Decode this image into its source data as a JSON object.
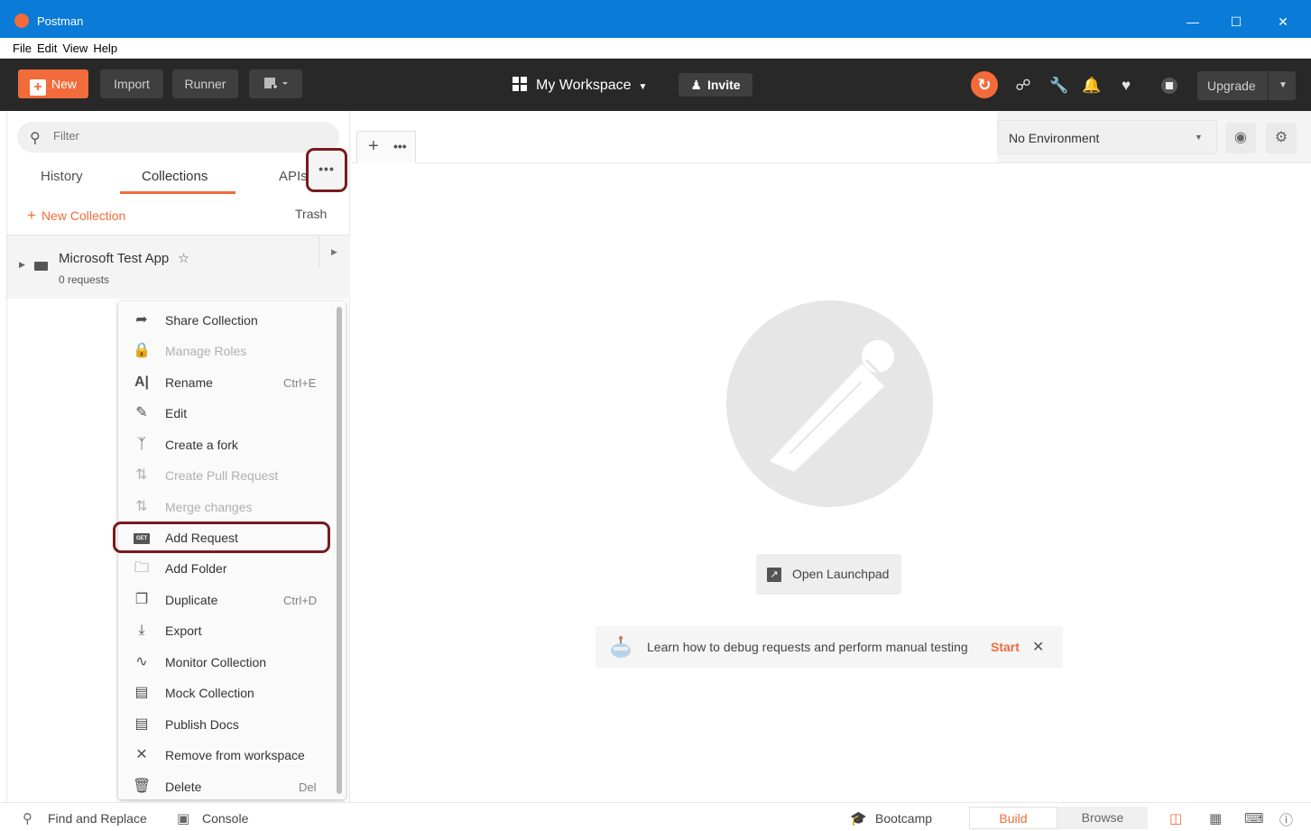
{
  "window": {
    "title": "Postman",
    "minimize": "—",
    "maximize": "☐",
    "close": "✕"
  },
  "menubar": [
    "File",
    "Edit",
    "View",
    "Help"
  ],
  "toolbar": {
    "new_label": "New",
    "import_label": "Import",
    "runner_label": "Runner",
    "workspace_label": "My Workspace",
    "invite_label": "Invite",
    "upgrade_label": "Upgrade"
  },
  "sidebar": {
    "filter_placeholder": "Filter",
    "tabs": [
      "History",
      "Collections",
      "APIs"
    ],
    "active_tab": "Collections",
    "new_collection_label": "New Collection",
    "trash_label": "Trash",
    "collection": {
      "name": "Microsoft Test App",
      "count": "0 requests"
    }
  },
  "context_menu": {
    "items": [
      {
        "label": "Share Collection",
        "icon": "share-arrow-icon",
        "shortcut": "",
        "disabled": false
      },
      {
        "label": "Manage Roles",
        "icon": "lock-icon",
        "shortcut": "",
        "disabled": true
      },
      {
        "label": "Rename",
        "icon": "rename-icon",
        "shortcut": "Ctrl+E",
        "disabled": false
      },
      {
        "label": "Edit",
        "icon": "pencil-icon",
        "shortcut": "",
        "disabled": false
      },
      {
        "label": "Create a fork",
        "icon": "fork-icon",
        "shortcut": "",
        "disabled": false
      },
      {
        "label": "Create Pull Request",
        "icon": "pull-request-icon",
        "shortcut": "",
        "disabled": true
      },
      {
        "label": "Merge changes",
        "icon": "merge-icon",
        "shortcut": "",
        "disabled": true
      },
      {
        "label": "Add Request",
        "icon": "get-request-icon",
        "shortcut": "",
        "disabled": false
      },
      {
        "label": "Add Folder",
        "icon": "add-folder-icon",
        "shortcut": "",
        "disabled": false
      },
      {
        "label": "Duplicate",
        "icon": "duplicate-icon",
        "shortcut": "Ctrl+D",
        "disabled": false
      },
      {
        "label": "Export",
        "icon": "download-icon",
        "shortcut": "",
        "disabled": false
      },
      {
        "label": "Monitor Collection",
        "icon": "pulse-icon",
        "shortcut": "",
        "disabled": false
      },
      {
        "label": "Mock Collection",
        "icon": "server-icon",
        "shortcut": "",
        "disabled": false
      },
      {
        "label": "Publish Docs",
        "icon": "docs-icon",
        "shortcut": "",
        "disabled": false
      },
      {
        "label": "Remove from workspace",
        "icon": "close-icon",
        "shortcut": "",
        "disabled": false
      },
      {
        "label": "Delete",
        "icon": "trash-icon",
        "shortcut": "Del",
        "disabled": false
      }
    ],
    "get_badge": "GET"
  },
  "main": {
    "environment_label": "No Environment",
    "open_launchpad_label": "Open Launchpad",
    "tip_text": "Learn how to debug requests and perform manual testing",
    "tip_start": "Start"
  },
  "statusbar": {
    "find_replace": "Find and Replace",
    "console": "Console",
    "bootcamp": "Bootcamp",
    "build": "Build",
    "browse": "Browse"
  },
  "colors": {
    "accent": "#f26b3a",
    "titlebar": "#0a7bd6",
    "toolbar": "#282828",
    "highlight": "#7a1a1e"
  }
}
